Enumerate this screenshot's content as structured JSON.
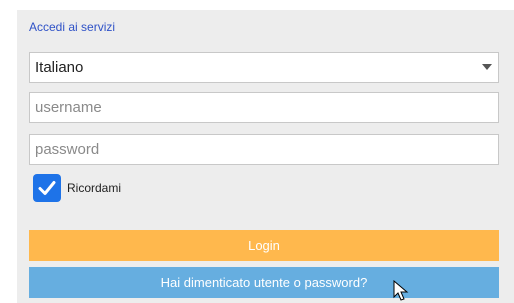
{
  "form": {
    "title": "Accedi ai servizi",
    "language": {
      "selected": "Italiano"
    },
    "username": {
      "placeholder": "username",
      "value": ""
    },
    "password": {
      "placeholder": "password",
      "value": ""
    },
    "remember": {
      "label": "Ricordami",
      "checked": true
    },
    "login_label": "Login",
    "forgot_label": "Hai dimenticato utente o password?"
  },
  "colors": {
    "panel": "#ededed",
    "login_button": "#ffb84d",
    "forgot_button": "#66aee0",
    "checkbox": "#1e73e8",
    "title_link": "#2f52c7"
  },
  "icons": {
    "dropdown": "chevron-down-icon",
    "checkbox": "check-icon",
    "cursor": "mouse-pointer-icon"
  }
}
